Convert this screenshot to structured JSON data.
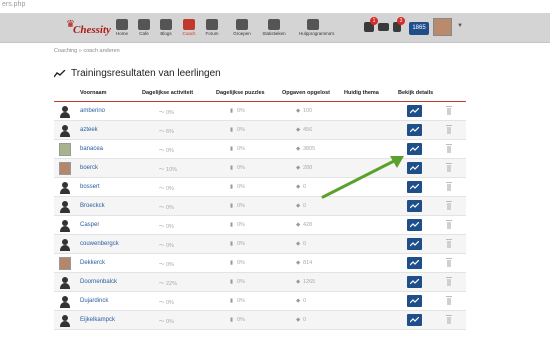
{
  "url": "ers.php",
  "nav": {
    "items": [
      {
        "label": "Home",
        "name": "nav-home"
      },
      {
        "label": "Cafe",
        "name": "nav-cafe"
      },
      {
        "label": "Blogs",
        "name": "nav-blogs"
      },
      {
        "label": "Coach",
        "name": "nav-coach"
      },
      {
        "label": "Forum",
        "name": "nav-forum"
      },
      {
        "label": "Groepen",
        "name": "nav-groepen"
      },
      {
        "label": "Statistieken",
        "name": "nav-statistieken"
      },
      {
        "label": "Hulpprogramma's",
        "name": "nav-hulpprogrammas"
      }
    ],
    "active": "Coach",
    "notifications_count": "1",
    "messages_count": "",
    "flag_count": "3",
    "rating": "1865"
  },
  "logo_text": "Chessity",
  "breadcrumb": "Coaching » coach anderen",
  "page_title": "Trainingsresultaten van leerlingen",
  "table": {
    "headers": [
      "Voornaam",
      "Dagelijkse activiteit",
      "Dagelijkse puzzles",
      "Opgaven opgelost",
      "Huidig thema",
      "Bekijk details"
    ],
    "rows": [
      {
        "name": "amberino",
        "activity": "0%",
        "puzzles": "0%",
        "solved": "100",
        "avatar": "silhouette"
      },
      {
        "name": "azteek",
        "activity": "6%",
        "puzzles": "0%",
        "solved": "456",
        "avatar": "silhouette"
      },
      {
        "name": "banacea",
        "activity": "0%",
        "puzzles": "0%",
        "solved": "3805",
        "avatar": "photo-green"
      },
      {
        "name": "boerck",
        "activity": "10%",
        "puzzles": "0%",
        "solved": "288",
        "avatar": "photo"
      },
      {
        "name": "bossert",
        "activity": "0%",
        "puzzles": "0%",
        "solved": "0",
        "avatar": "silhouette"
      },
      {
        "name": "Broeckck",
        "activity": "0%",
        "puzzles": "0%",
        "solved": "0",
        "avatar": "silhouette"
      },
      {
        "name": "Casper",
        "activity": "0%",
        "puzzles": "0%",
        "solved": "428",
        "avatar": "silhouette"
      },
      {
        "name": "couwenbergck",
        "activity": "0%",
        "puzzles": "0%",
        "solved": "0",
        "avatar": "silhouette"
      },
      {
        "name": "Dekkerck",
        "activity": "0%",
        "puzzles": "0%",
        "solved": "814",
        "avatar": "photo"
      },
      {
        "name": "Doornenbalck",
        "activity": "22%",
        "puzzles": "0%",
        "solved": "1265",
        "avatar": "silhouette"
      },
      {
        "name": "Dujardinck",
        "activity": "0%",
        "puzzles": "0%",
        "solved": "0",
        "avatar": "silhouette"
      },
      {
        "name": "Eijkelkampck",
        "activity": "0%",
        "puzzles": "0%",
        "solved": "0",
        "avatar": "silhouette"
      }
    ]
  },
  "colors": {
    "accent_red": "#c0392b",
    "link_blue": "#2a5d9f",
    "button_blue": "#1f4f8b",
    "arrow_green": "#5aa02c"
  }
}
